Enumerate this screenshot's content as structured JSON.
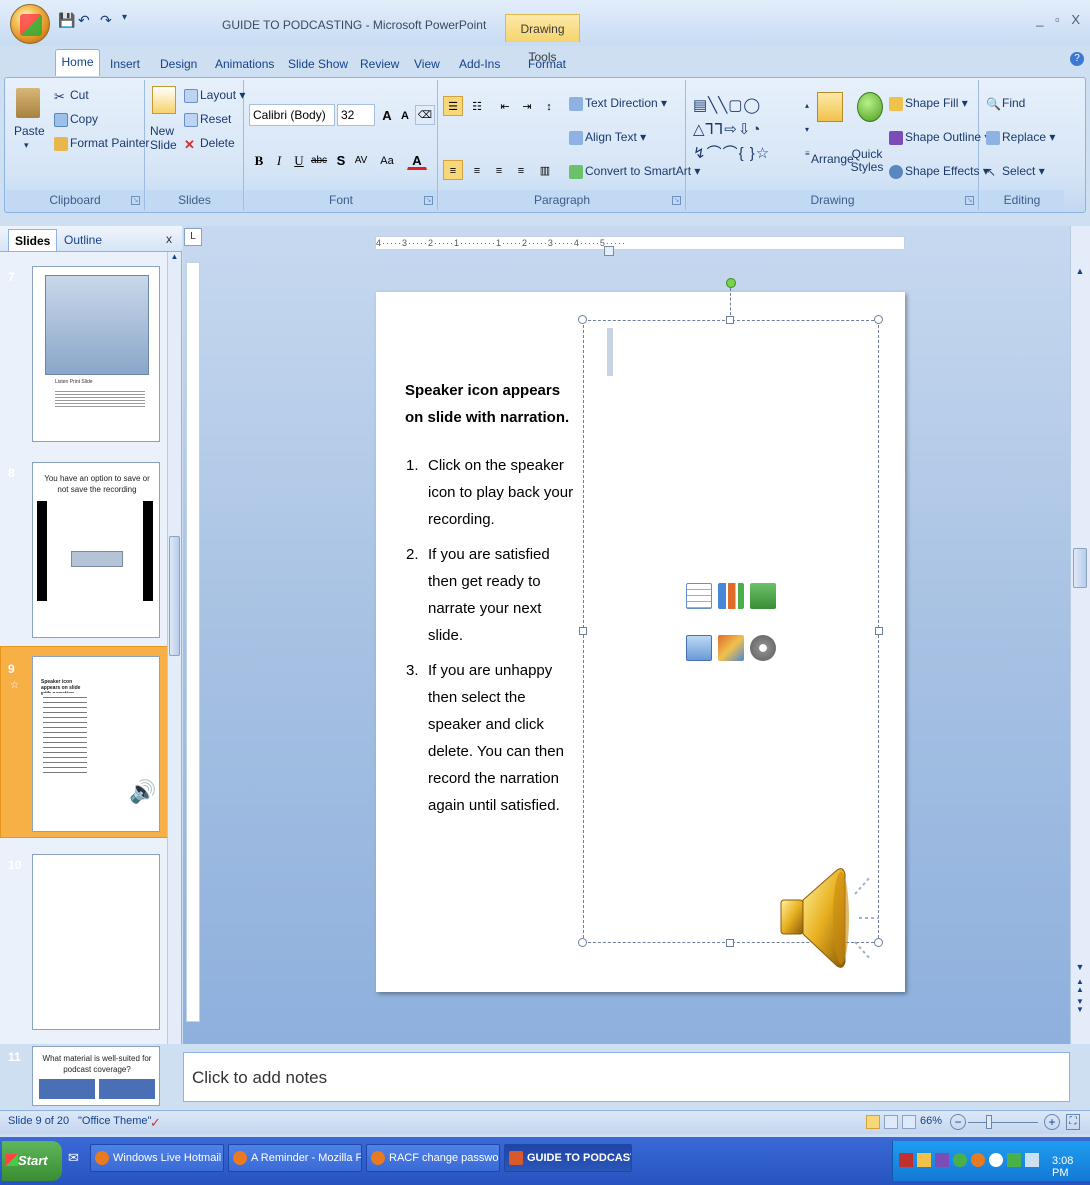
{
  "window": {
    "title": "GUIDE TO PODCASTING - Microsoft PowerPoint",
    "contextual_tab": "Drawing Tools",
    "controls": "_ ▫ X"
  },
  "tabs": [
    "Home",
    "Insert",
    "Design",
    "Animations",
    "Slide Show",
    "Review",
    "View",
    "Add-Ins",
    "Format"
  ],
  "ribbon": {
    "clipboard": {
      "label": "Clipboard",
      "paste": "Paste",
      "cut": "Cut",
      "copy": "Copy",
      "format_painter": "Format Painter"
    },
    "slides": {
      "label": "Slides",
      "new_slide": "New Slide",
      "layout": "Layout",
      "reset": "Reset",
      "delete": "Delete"
    },
    "font": {
      "label": "Font",
      "font_name": "Calibri (Body)",
      "font_size": "32"
    },
    "paragraph": {
      "label": "Paragraph",
      "text_direction": "Text Direction",
      "align_text": "Align Text",
      "convert": "Convert to SmartArt"
    },
    "drawing": {
      "label": "Drawing",
      "arrange": "Arrange",
      "quick_styles": "Quick Styles",
      "shape_fill": "Shape Fill",
      "shape_outline": "Shape Outline",
      "shape_effects": "Shape Effects"
    },
    "editing": {
      "label": "Editing",
      "find": "Find",
      "replace": "Replace",
      "select": "Select"
    }
  },
  "pane": {
    "tab_slides": "Slides",
    "tab_outline": "Outline",
    "close": "x",
    "thumbs": [
      {
        "num": "7",
        "caption": "Listen Print Slide"
      },
      {
        "num": "8",
        "caption": "You have an option to save or not save the recording"
      },
      {
        "num": "9",
        "caption": "Speaker icon appears on slide with narration"
      },
      {
        "num": "10",
        "caption": ""
      },
      {
        "num": "11",
        "caption": "What material is well-suited for podcast coverage?"
      }
    ]
  },
  "ruler_corner": "L",
  "hruler_text": "4·····3·····2·····1·········1·····2·····3·····4·····5·····",
  "slide": {
    "title": "Speaker icon appears on slide with narration.",
    "items": [
      {
        "n": "1.",
        "text": "Click on the speaker icon to play back your recording."
      },
      {
        "n": "2.",
        "text": "If you are satisfied then get ready to narrate your next slide."
      },
      {
        "n": "3.",
        "text": "If you are unhappy then select the speaker and click delete. You can then record the narration again until satisfied."
      }
    ]
  },
  "notes_placeholder": "Click to add notes",
  "status": {
    "slide_info": "Slide 9 of 20",
    "theme": "\"Office Theme\"",
    "zoom": "66%"
  },
  "taskbar": {
    "start": "Start",
    "tasks": [
      {
        "label": "Windows Live Hotmail - ...",
        "active": false
      },
      {
        "label": "A Reminder - Mozilla Fire...",
        "active": false
      },
      {
        "label": "RACF change password....",
        "active": false
      },
      {
        "label": "GUIDE TO PODCASTING",
        "active": true
      }
    ],
    "clock": "3:08 PM"
  }
}
